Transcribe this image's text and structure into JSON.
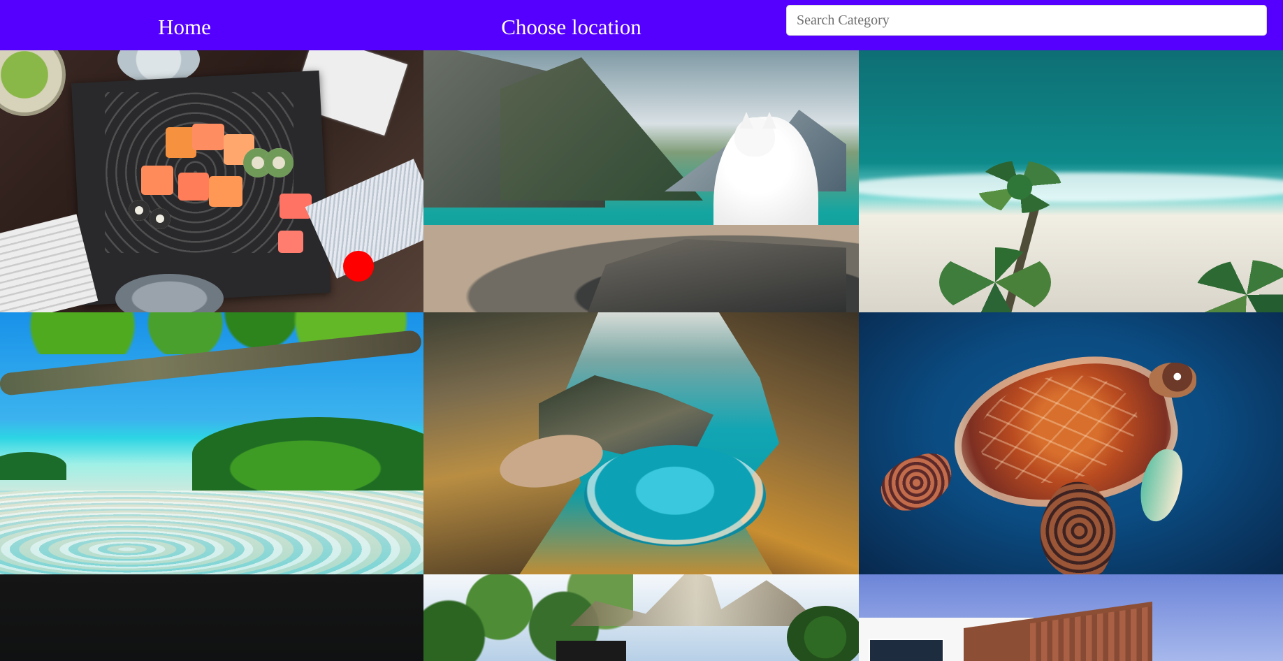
{
  "nav": {
    "home_label": "Home",
    "location_label": "Choose location"
  },
  "search": {
    "placeholder": "Search Category",
    "value": ""
  },
  "gallery": {
    "items": [
      {
        "subject": "sushi platter"
      },
      {
        "subject": "white dog by mountain lake"
      },
      {
        "subject": "beach with palm trees"
      },
      {
        "subject": "tropical beach with tree branch"
      },
      {
        "subject": "coastal cove"
      },
      {
        "subject": "sea turtle"
      },
      {
        "subject": "dark night scene"
      },
      {
        "subject": "house among trees"
      },
      {
        "subject": "modern building"
      }
    ]
  },
  "colors": {
    "navbar": "#5500ff",
    "nav_text": "#ffffff",
    "search_background": "#ffffff"
  }
}
